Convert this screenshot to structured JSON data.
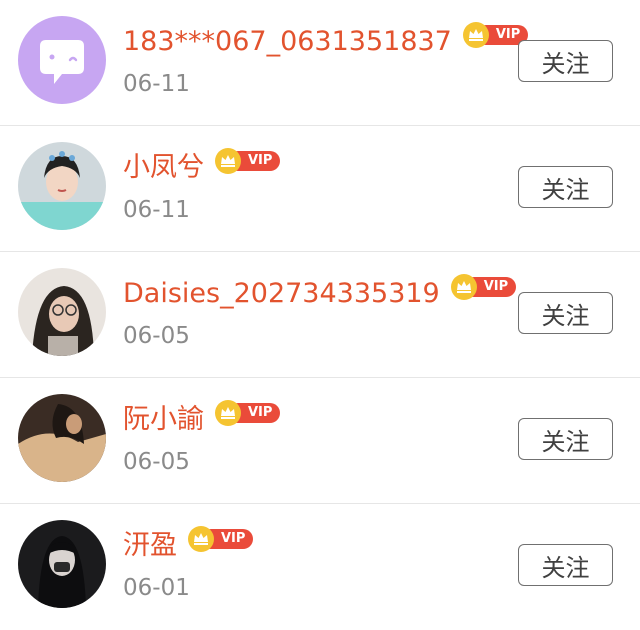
{
  "theme": {
    "name_color": "#e2532e",
    "vip_color": "#ea4b3a",
    "crown_color": "#f5c431"
  },
  "follow_label": "关注",
  "users": [
    {
      "name": "183***067_0631351837",
      "date": "06-11",
      "vip": "VIP",
      "avatar": "chat-bubble-icon"
    },
    {
      "name": "小凤兮",
      "date": "06-11",
      "vip": "VIP",
      "avatar": "user-photo"
    },
    {
      "name": "Daisies_202734335319",
      "date": "06-05",
      "vip": "VIP",
      "avatar": "user-photo"
    },
    {
      "name": "阮小諭",
      "date": "06-05",
      "vip": "VIP",
      "avatar": "user-photo"
    },
    {
      "name": "汧盈",
      "date": "06-01",
      "vip": "VIP",
      "avatar": "user-photo"
    }
  ]
}
